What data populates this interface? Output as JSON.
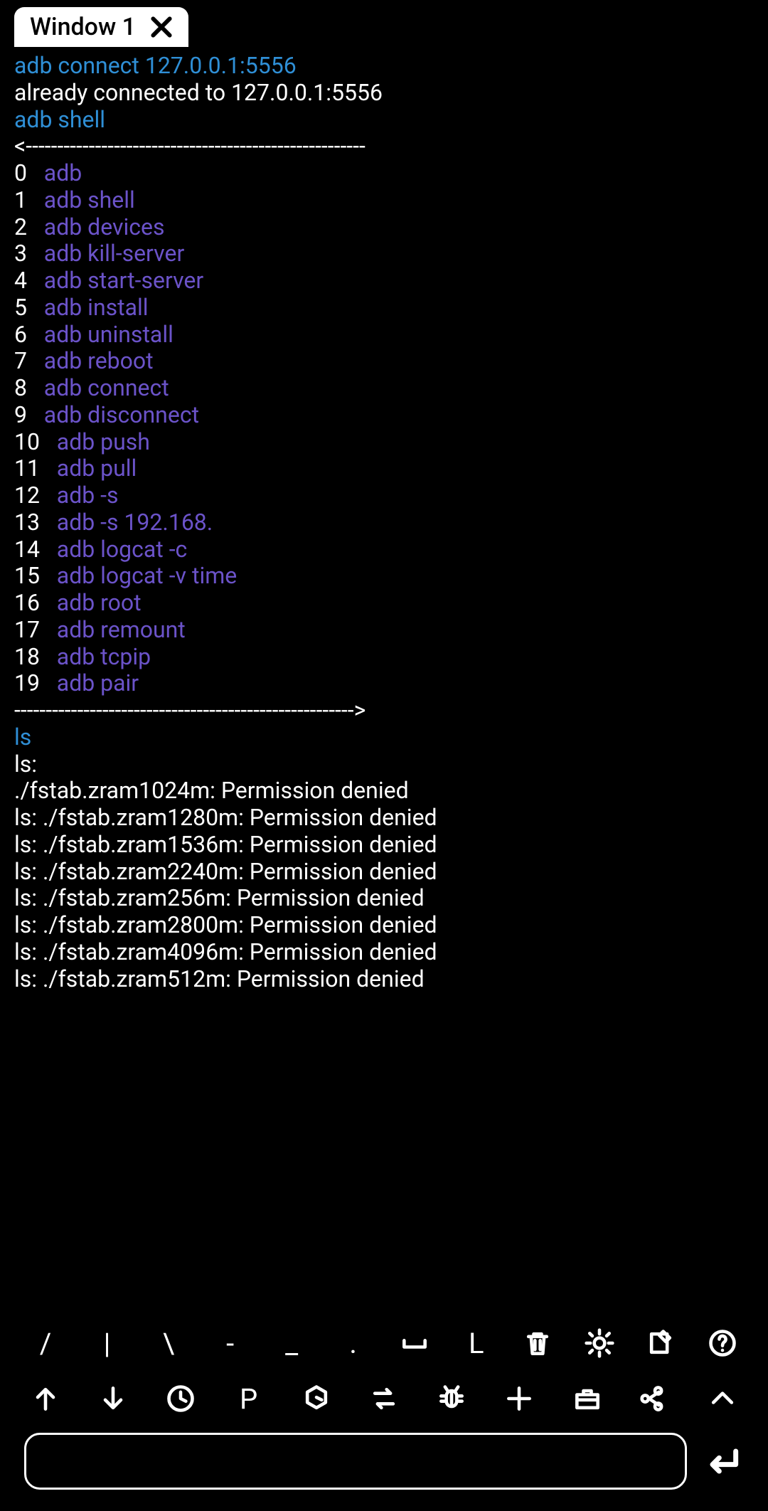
{
  "tab": {
    "label": "Window 1"
  },
  "terminal": {
    "lines": [
      {
        "segments": [
          {
            "class": "blue",
            "text": "adb connect 127.0.0.1:5556"
          }
        ]
      },
      {
        "segments": [
          {
            "class": "white",
            "text": "already connected to 127.0.0.1:5556"
          }
        ]
      },
      {
        "segments": [
          {
            "class": "blue",
            "text": "adb shell"
          }
        ]
      },
      {
        "segments": [
          {
            "class": "white",
            "text": "<------------------------------------------------------"
          }
        ]
      }
    ],
    "suggestions": [
      {
        "n": "0",
        "cmd": "adb"
      },
      {
        "n": "1",
        "cmd": "adb shell"
      },
      {
        "n": "2",
        "cmd": "adb devices"
      },
      {
        "n": "3",
        "cmd": "adb kill-server"
      },
      {
        "n": "4",
        "cmd": "adb start-server"
      },
      {
        "n": "5",
        "cmd": "adb install"
      },
      {
        "n": "6",
        "cmd": "adb uninstall"
      },
      {
        "n": "7",
        "cmd": "adb reboot"
      },
      {
        "n": "8",
        "cmd": "adb connect"
      },
      {
        "n": "9",
        "cmd": "adb disconnect"
      },
      {
        "n": "10",
        "cmd": "adb push"
      },
      {
        "n": "11",
        "cmd": "adb pull"
      },
      {
        "n": "12",
        "cmd": "adb -s"
      },
      {
        "n": "13",
        "cmd": "adb -s 192.168."
      },
      {
        "n": "14",
        "cmd": "adb logcat -c"
      },
      {
        "n": "15",
        "cmd": "adb logcat -v time"
      },
      {
        "n": "16",
        "cmd": "adb root"
      },
      {
        "n": "17",
        "cmd": "adb remount"
      },
      {
        "n": "18",
        "cmd": "adb tcpip"
      },
      {
        "n": "19",
        "cmd": "adb pair"
      }
    ],
    "divider_end": "------------------------------------------------------>",
    "after": [
      {
        "segments": [
          {
            "class": "blue",
            "text": "ls"
          }
        ]
      },
      {
        "segments": [
          {
            "class": "white",
            "text": "ls:"
          }
        ]
      },
      {
        "segments": [
          {
            "class": "white",
            "text": "./fstab.zram1024m: Permission denied"
          }
        ]
      },
      {
        "segments": [
          {
            "class": "white",
            "text": "ls: ./fstab.zram1280m: Permission denied"
          }
        ]
      },
      {
        "segments": [
          {
            "class": "white",
            "text": "ls: ./fstab.zram1536m: Permission denied"
          }
        ]
      },
      {
        "segments": [
          {
            "class": "white",
            "text": "ls: ./fstab.zram2240m: Permission denied"
          }
        ]
      },
      {
        "segments": [
          {
            "class": "white",
            "text": "ls: ./fstab.zram256m: Permission denied"
          }
        ]
      },
      {
        "segments": [
          {
            "class": "white",
            "text": "ls: ./fstab.zram2800m: Permission denied"
          }
        ]
      },
      {
        "segments": [
          {
            "class": "white",
            "text": "ls: ./fstab.zram4096m: Permission denied"
          }
        ]
      },
      {
        "segments": [
          {
            "class": "white",
            "text": "ls: ./fstab.zram512m: Permission denied"
          }
        ]
      }
    ]
  },
  "toolbar_row1": [
    {
      "name": "slash-key",
      "glyph": "/"
    },
    {
      "name": "pipe-key",
      "glyph": "|"
    },
    {
      "name": "backslash-key",
      "glyph": "\\"
    },
    {
      "name": "dash-key",
      "glyph": "-"
    },
    {
      "name": "underscore-key",
      "glyph": "_"
    },
    {
      "name": "dot-key",
      "glyph": "."
    },
    {
      "name": "space-key",
      "glyph": "␣",
      "svg": "space"
    },
    {
      "name": "l-key",
      "glyph": "L"
    },
    {
      "name": "trash-icon",
      "svg": "trash"
    },
    {
      "name": "settings-icon",
      "svg": "gear"
    },
    {
      "name": "edit-icon",
      "svg": "edit"
    },
    {
      "name": "help-icon",
      "svg": "help"
    }
  ],
  "toolbar_row2": [
    {
      "name": "arrow-up-icon",
      "svg": "up"
    },
    {
      "name": "arrow-down-icon",
      "svg": "down"
    },
    {
      "name": "clock-icon",
      "svg": "clock"
    },
    {
      "name": "p-key",
      "glyph": "P"
    },
    {
      "name": "hex-icon",
      "svg": "hex"
    },
    {
      "name": "swap-icon",
      "svg": "swap"
    },
    {
      "name": "bug-icon",
      "svg": "bug"
    },
    {
      "name": "plus-icon",
      "svg": "plus"
    },
    {
      "name": "briefcase-icon",
      "svg": "briefcase"
    },
    {
      "name": "share-icon",
      "svg": "share"
    },
    {
      "name": "chevron-up-icon",
      "svg": "chevup"
    }
  ],
  "input": {
    "value": ""
  }
}
